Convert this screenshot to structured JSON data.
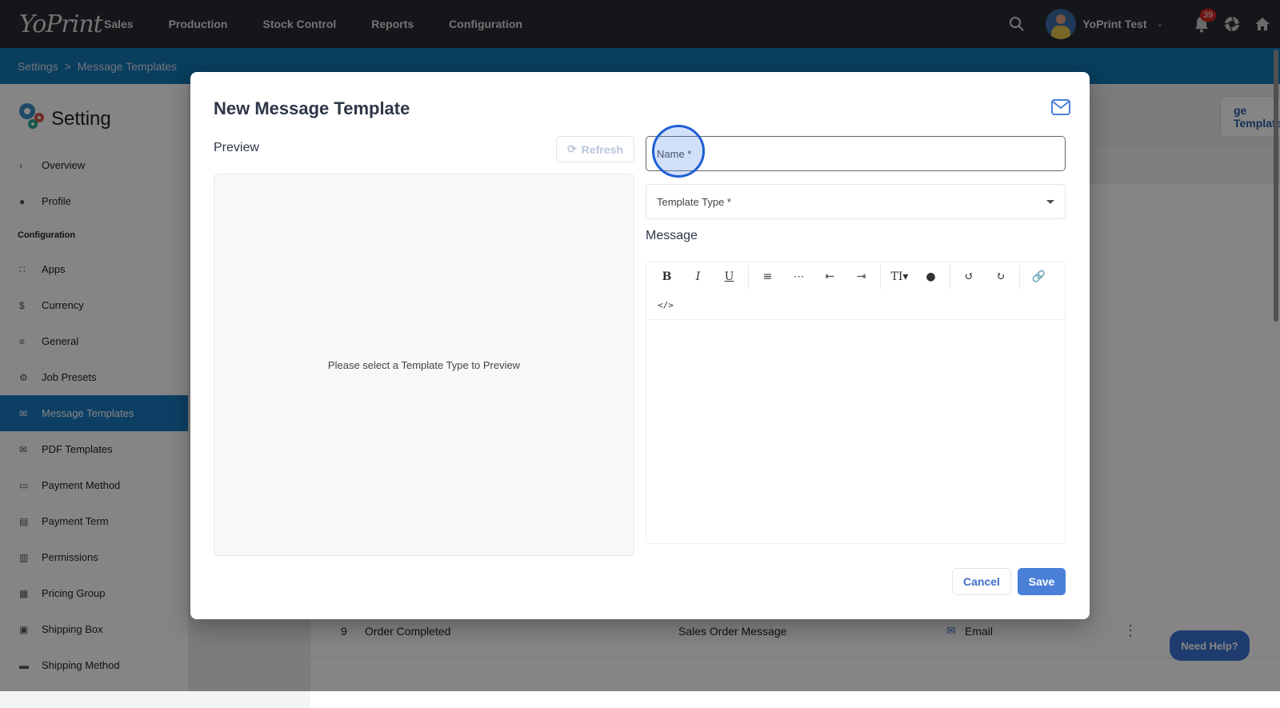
{
  "topbar": {
    "logo": "YoPrint",
    "nav": [
      "Sales",
      "Production",
      "Stock Control",
      "Reports",
      "Configuration"
    ],
    "user": "YoPrint Test",
    "notifications": "39"
  },
  "breadcrumb": [
    "Settings",
    ">",
    "Message Templates"
  ],
  "sidebar": {
    "title": "Setting",
    "items_top": [
      {
        "icon": "chevron-right",
        "label": "Overview"
      },
      {
        "icon": "person",
        "label": "Profile"
      }
    ],
    "section": "Configuration",
    "items": [
      {
        "icon": "grid",
        "label": "Apps"
      },
      {
        "icon": "dollar",
        "label": "Currency"
      },
      {
        "icon": "sliders",
        "label": "General"
      },
      {
        "icon": "gear",
        "label": "Job Presets"
      },
      {
        "icon": "mail",
        "label": "Message Templates",
        "active": true
      },
      {
        "icon": "mail",
        "label": "PDF Templates"
      },
      {
        "icon": "card",
        "label": "Payment Method"
      },
      {
        "icon": "clipboard",
        "label": "Payment Term"
      },
      {
        "icon": "doc",
        "label": "Permissions"
      },
      {
        "icon": "calendar",
        "label": "Pricing Group"
      },
      {
        "icon": "box",
        "label": "Shipping Box"
      },
      {
        "icon": "truck",
        "label": "Shipping Method"
      }
    ]
  },
  "background": {
    "header_button": "ge Template",
    "row": {
      "num": "9",
      "name": "Order Completed",
      "type": "Sales Order Message",
      "channel": "Email"
    },
    "need_help": "Need Help?"
  },
  "modal": {
    "title": "New Message Template",
    "preview_label": "Preview",
    "refresh": "Refresh",
    "preview_placeholder": "Please select a Template Type to Preview",
    "name_label": "Name *",
    "name_value": "",
    "template_type_label": "Template Type *",
    "message_label": "Message",
    "toolbar": [
      "B",
      "I",
      "U",
      "ordered-list",
      "bullet-list",
      "outdent",
      "indent",
      "text-size",
      "color",
      "undo",
      "redo",
      "link",
      "code"
    ],
    "cancel": "Cancel",
    "save": "Save"
  },
  "colors": {
    "accent": "#4a7fd8",
    "topbar": "#2a2b31",
    "breadcrumb": "#1378b4"
  }
}
